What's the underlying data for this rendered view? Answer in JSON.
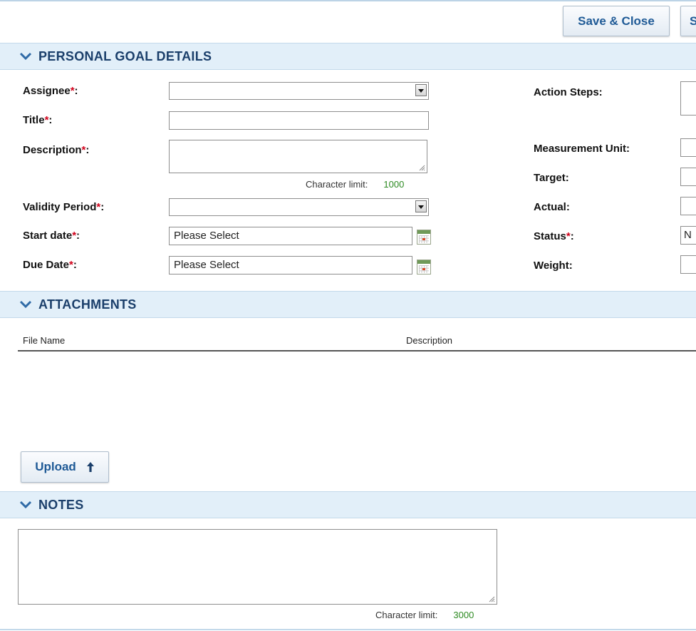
{
  "toolbar": {
    "save_close_label": "Save & Close",
    "save_label": "S"
  },
  "sections": {
    "personal_goal": "PERSONAL GOAL DETAILS",
    "attachments": "ATTACHMENTS",
    "notes": "NOTES"
  },
  "required_marker": "*",
  "form_left": {
    "assignee": {
      "label": "Assignee",
      "suffix": ":",
      "required": true,
      "value": ""
    },
    "title": {
      "label": "Title",
      "suffix": ":",
      "required": true,
      "value": ""
    },
    "description": {
      "label": "Description",
      "suffix": ":",
      "required": true,
      "value": "",
      "char_limit_label": "Character limit:",
      "char_limit_value": "1000"
    },
    "validity_period": {
      "label": "Validity Period",
      "suffix": ":",
      "required": true,
      "value": ""
    },
    "start_date": {
      "label": "Start date",
      "suffix": ":",
      "required": true,
      "value": "Please Select"
    },
    "due_date": {
      "label": "Due Date",
      "suffix": ":",
      "required": true,
      "value": "Please Select"
    }
  },
  "form_right": {
    "action_steps": {
      "label": "Action Steps:",
      "value": ""
    },
    "measurement_unit": {
      "label": "Measurement Unit:",
      "value": ""
    },
    "target": {
      "label": "Target:",
      "value": ""
    },
    "actual": {
      "label": "Actual:",
      "value": ""
    },
    "status": {
      "label": "Status",
      "suffix": ":",
      "required": true,
      "value": "N"
    },
    "weight": {
      "label": "Weight:",
      "value": ""
    }
  },
  "attachments": {
    "columns": [
      "File Name",
      "Description"
    ],
    "rows": [],
    "upload_label": "Upload"
  },
  "notes": {
    "value": "",
    "char_limit_label": "Character limit:",
    "char_limit_value": "3000"
  },
  "icons": {
    "section_toggle": "chevron-down-icon",
    "dropdown": "dropdown-arrow-icon",
    "calendar": "calendar-icon",
    "upload": "arrow-up-icon",
    "resize": "resize-grip-icon"
  },
  "colors": {
    "section_bg": "#e2eff9",
    "section_title": "#1b3f6b",
    "button_text": "#1f5a96",
    "required": "#d0021b",
    "char_limit_number": "#2d8a22"
  }
}
